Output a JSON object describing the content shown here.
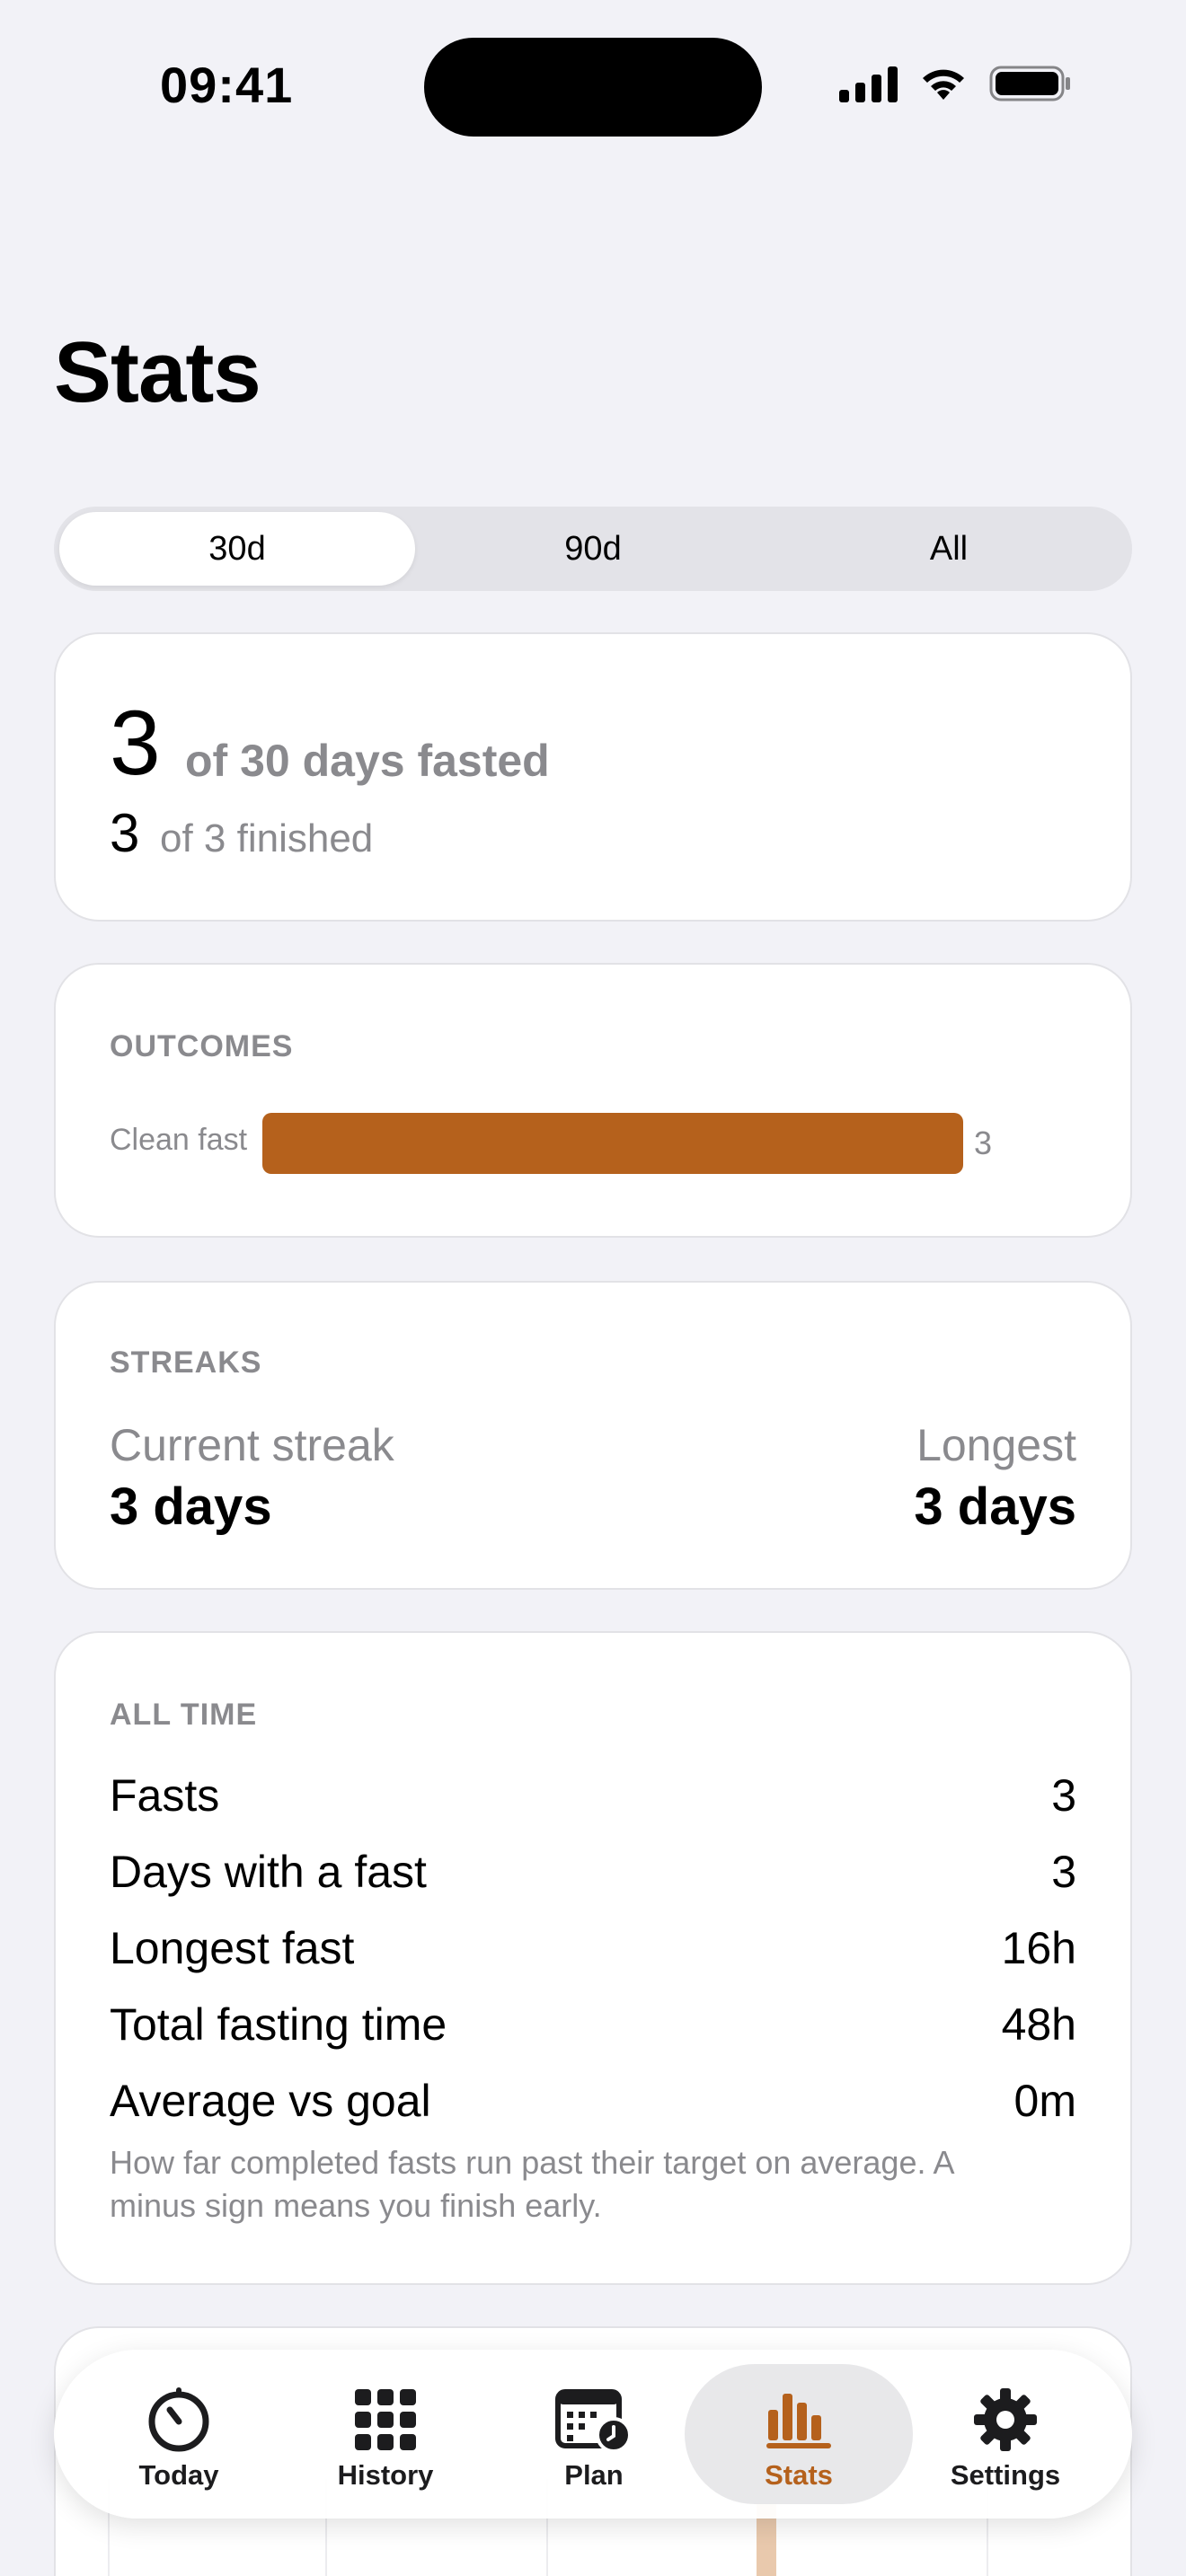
{
  "status_bar": {
    "time": "09:41"
  },
  "page": {
    "title": "Stats"
  },
  "range_selector": {
    "options": [
      "30d",
      "90d",
      "All"
    ],
    "selected": "30d"
  },
  "summary": {
    "days_fasted": "3",
    "days_fasted_label": "of 30 days fasted",
    "finished": "3",
    "finished_label": "of 3 finished"
  },
  "outcomes": {
    "heading": "OUTCOMES",
    "items": [
      {
        "label": "Clean fast",
        "value": "3",
        "fraction": 1.0
      }
    ],
    "accent_color": "#b5611c"
  },
  "streaks": {
    "heading": "STREAKS",
    "current_label": "Current streak",
    "current_value": "3 days",
    "longest_label": "Longest",
    "longest_value": "3 days"
  },
  "all_time": {
    "heading": "ALL TIME",
    "rows": [
      {
        "label": "Fasts",
        "value": "3"
      },
      {
        "label": "Days with a fast",
        "value": "3"
      },
      {
        "label": "Longest fast",
        "value": "16h"
      },
      {
        "label": "Total fasting time",
        "value": "48h"
      },
      {
        "label": "Average vs goal",
        "value": "0m"
      }
    ],
    "note": "How far completed fasts run past their target on average. A minus sign means you finish early."
  },
  "tab_bar": {
    "tabs": [
      {
        "label": "Today",
        "icon": "timer-icon"
      },
      {
        "label": "History",
        "icon": "grid-icon"
      },
      {
        "label": "Plan",
        "icon": "calendar-clock-icon"
      },
      {
        "label": "Stats",
        "icon": "bar-chart-icon"
      },
      {
        "label": "Settings",
        "icon": "gear-icon"
      }
    ],
    "active": "Stats",
    "active_color": "#b5611c"
  }
}
